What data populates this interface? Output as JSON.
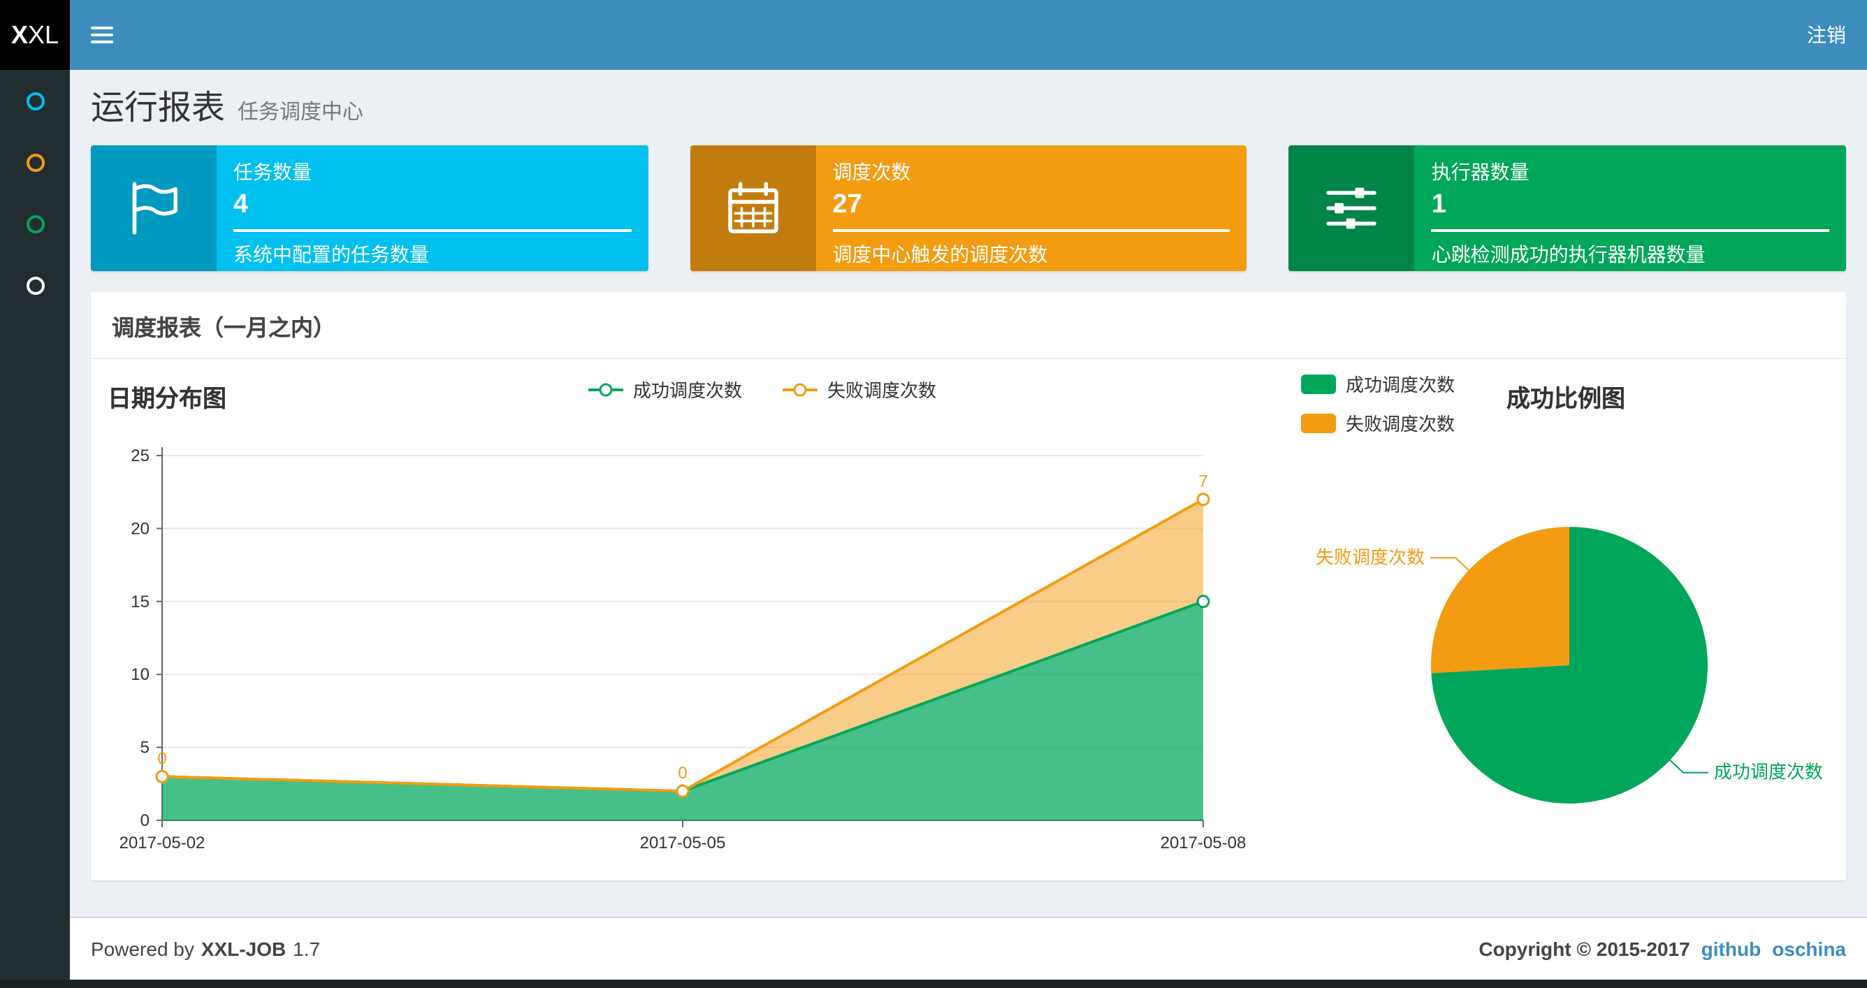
{
  "navbar": {
    "logo_bold": "X",
    "logo_rest": "XL",
    "logout": "注销"
  },
  "sidebar": {
    "items": [
      {
        "name": "menu-item-1",
        "color": "#00c0ef"
      },
      {
        "name": "menu-item-2",
        "color": "#f39c12"
      },
      {
        "name": "menu-item-3",
        "color": "#00a65a"
      },
      {
        "name": "menu-item-4",
        "color": "#ffffff"
      }
    ]
  },
  "page": {
    "title": "运行报表",
    "subtitle": "任务调度中心"
  },
  "info_boxes": [
    {
      "title": "任务数量",
      "value": "4",
      "desc": "系统中配置的任务数量",
      "bg": "#00c0ef",
      "icon": "flag-icon"
    },
    {
      "title": "调度次数",
      "value": "27",
      "desc": "调度中心触发的调度次数",
      "bg": "#f39c12",
      "icon": "calendar-icon"
    },
    {
      "title": "执行器数量",
      "value": "1",
      "desc": "心跳检测成功的执行器机器数量",
      "bg": "#00a65a",
      "icon": "sliders-icon"
    }
  ],
  "panel": {
    "title": "调度报表（一月之内）"
  },
  "chart_data": [
    {
      "type": "area",
      "title": "日期分布图",
      "stacked": true,
      "x": [
        "2017-05-02",
        "2017-05-05",
        "2017-05-08"
      ],
      "series": [
        {
          "name": "成功调度次数",
          "values": [
            3,
            2,
            15
          ],
          "color": "#00a65a"
        },
        {
          "name": "失败调度次数",
          "values": [
            0,
            0,
            7
          ],
          "color": "#f39c12"
        }
      ],
      "point_labels_series": "失败调度次数",
      "point_labels": [
        0,
        0,
        7
      ],
      "ylim": [
        0,
        25
      ],
      "yticks": [
        0,
        5,
        10,
        15,
        20,
        25
      ],
      "legend_position": "top",
      "grid": true
    },
    {
      "type": "pie",
      "title": "成功比例图",
      "slices": [
        {
          "name": "成功调度次数",
          "value": 20,
          "color": "#00a65a"
        },
        {
          "name": "失败调度次数",
          "value": 7,
          "color": "#f39c12"
        }
      ],
      "legend_position": "top-left",
      "start_angle_deg": 90,
      "direction": "clockwise"
    }
  ],
  "footer": {
    "powered_prefix": "Powered by",
    "brand": "XXL-JOB",
    "version": "1.7",
    "copyright": "Copyright © 2015-2017",
    "links": [
      "github",
      "oschina"
    ]
  },
  "colors": {
    "navbar": "#3c8dbc",
    "sidebar": "#222d32",
    "content_bg": "#ecf0f5",
    "aqua": "#00c0ef",
    "yellow": "#f39c12",
    "green": "#00a65a",
    "link": "#3c8dbc"
  }
}
